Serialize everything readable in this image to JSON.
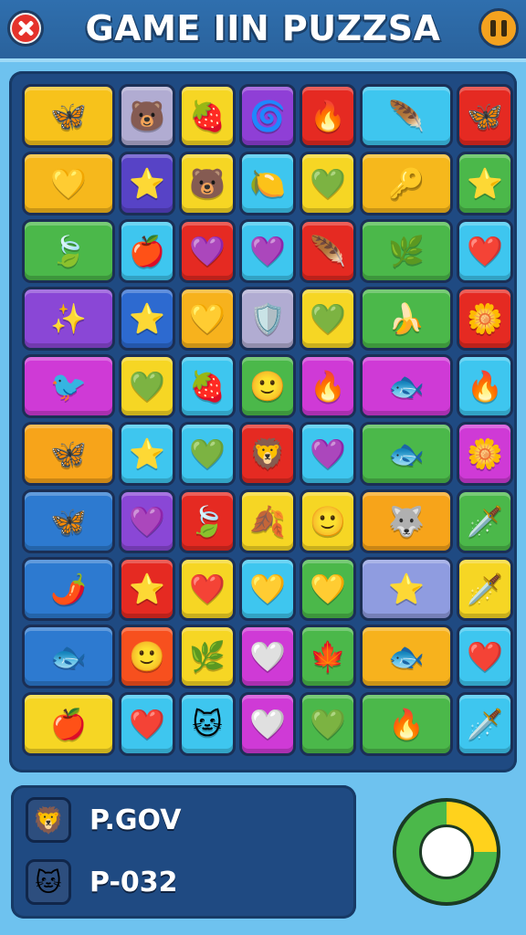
{
  "header": {
    "title": "GAME IIN PUZZSA",
    "close_icon": "close-icon",
    "pause_icon": "pause-icon"
  },
  "board": {
    "rows": [
      [
        [
          "wide",
          "#f7c21b",
          "🦋"
        ],
        [
          "n",
          "#b1acd2",
          "🐻"
        ],
        [
          "n",
          "#f6d624",
          "🍓"
        ],
        [
          "n",
          "#8f3fd6",
          "🌀"
        ],
        [
          "n",
          "#e52a22",
          "🔥"
        ],
        [
          "wide",
          "#3ec6ef",
          "🪶"
        ],
        [
          "n",
          "#e52a22",
          "🦋"
        ]
      ],
      [
        [
          "wide",
          "#f6b81c",
          "💛"
        ],
        [
          "n",
          "#5743c6",
          "⭐"
        ],
        [
          "n",
          "#f6d624",
          "🐻"
        ],
        [
          "n",
          "#3ec6ef",
          "🍋"
        ],
        [
          "n",
          "#f6d624",
          "💚"
        ],
        [
          "wide",
          "#f6b81c",
          "🔑"
        ],
        [
          "n",
          "#4bb84a",
          "⭐"
        ]
      ],
      [
        [
          "wide",
          "#4bb84a",
          "🍃"
        ],
        [
          "n",
          "#3ec6ef",
          "🍎"
        ],
        [
          "n",
          "#e52a22",
          "💜"
        ],
        [
          "n",
          "#3ec6ef",
          "💜"
        ],
        [
          "n",
          "#e52a22",
          "🪶"
        ],
        [
          "wide",
          "#4bb84a",
          "🌿"
        ],
        [
          "n",
          "#3ec6ef",
          "❤️"
        ]
      ],
      [
        [
          "wide",
          "#8a47d6",
          "✨"
        ],
        [
          "n",
          "#2d6ad0",
          "⭐"
        ],
        [
          "n",
          "#f7b21d",
          "💛"
        ],
        [
          "n",
          "#b1acd2",
          "🛡️"
        ],
        [
          "n",
          "#f6d624",
          "💚"
        ],
        [
          "wide",
          "#4bb84a",
          "🍌"
        ],
        [
          "n",
          "#e52a22",
          "🌼"
        ]
      ],
      [
        [
          "wide",
          "#cf3ad6",
          "🐦"
        ],
        [
          "n",
          "#f6d624",
          "💚"
        ],
        [
          "n",
          "#3ec6ef",
          "🍓"
        ],
        [
          "n",
          "#4bb84a",
          "🙂"
        ],
        [
          "n",
          "#cf3ad6",
          "🔥"
        ],
        [
          "wide",
          "#cf3ad6",
          "🐟"
        ],
        [
          "n",
          "#3ec6ef",
          "🔥"
        ]
      ],
      [
        [
          "wide",
          "#f7a41a",
          "🦋"
        ],
        [
          "n",
          "#3ec6ef",
          "⭐"
        ],
        [
          "n",
          "#3ec6ef",
          "💚"
        ],
        [
          "n",
          "#e52a22",
          "🦁"
        ],
        [
          "n",
          "#3ec6ef",
          "💜"
        ],
        [
          "wide",
          "#4bb84a",
          "🐟"
        ],
        [
          "n",
          "#cf3ad6",
          "🌼"
        ]
      ],
      [
        [
          "wide",
          "#2d7ad0",
          "🦋"
        ],
        [
          "n",
          "#8a47d6",
          "💜"
        ],
        [
          "n",
          "#e52a22",
          "🍃"
        ],
        [
          "n",
          "#f6d624",
          "🍂"
        ],
        [
          "n",
          "#f6d624",
          "🙂"
        ],
        [
          "wide",
          "#f7a41a",
          "🐺"
        ],
        [
          "n",
          "#4bb84a",
          "🗡️"
        ]
      ],
      [
        [
          "wide",
          "#2d7ad0",
          "🌶️"
        ],
        [
          "n",
          "#e52a22",
          "⭐"
        ],
        [
          "n",
          "#f6d624",
          "❤️"
        ],
        [
          "n",
          "#3ec6ef",
          "💛"
        ],
        [
          "n",
          "#4bb84a",
          "💛"
        ],
        [
          "wide",
          "#8f9ce0",
          "⭐"
        ],
        [
          "n",
          "#f6d624",
          "🗡️"
        ]
      ],
      [
        [
          "wide",
          "#2d7ad0",
          "🐟"
        ],
        [
          "n",
          "#f7501e",
          "🙂"
        ],
        [
          "n",
          "#f6d624",
          "🌿"
        ],
        [
          "n",
          "#cf3ad6",
          "🤍"
        ],
        [
          "n",
          "#4bb84a",
          "🍁"
        ],
        [
          "wide",
          "#f7b21d",
          "🐟"
        ],
        [
          "n",
          "#3ec6ef",
          "❤️"
        ]
      ],
      [
        [
          "wide",
          "#f6d624",
          "🍎"
        ],
        [
          "n",
          "#3ec6ef",
          "❤️"
        ],
        [
          "n",
          "#3ec6ef",
          "🐱"
        ],
        [
          "n",
          "#cf3ad6",
          "🤍"
        ],
        [
          "n",
          "#4bb84a",
          "💚"
        ],
        [
          "wide",
          "#4bb84a",
          "🔥"
        ],
        [
          "n",
          "#3ec6ef",
          "🗡️"
        ]
      ]
    ]
  },
  "players": [
    {
      "name": "P.GOV",
      "avatar_icon": "lion-avatar-icon",
      "avatar_glyph": "🦁"
    },
    {
      "name": "P-032",
      "avatar_icon": "cat-avatar-icon",
      "avatar_glyph": "🐱"
    }
  ],
  "timer": {
    "icon": "timer-ring-icon",
    "progress": 0.25,
    "fill_color": "#ffd21c",
    "track_color": "#4bb84a"
  }
}
